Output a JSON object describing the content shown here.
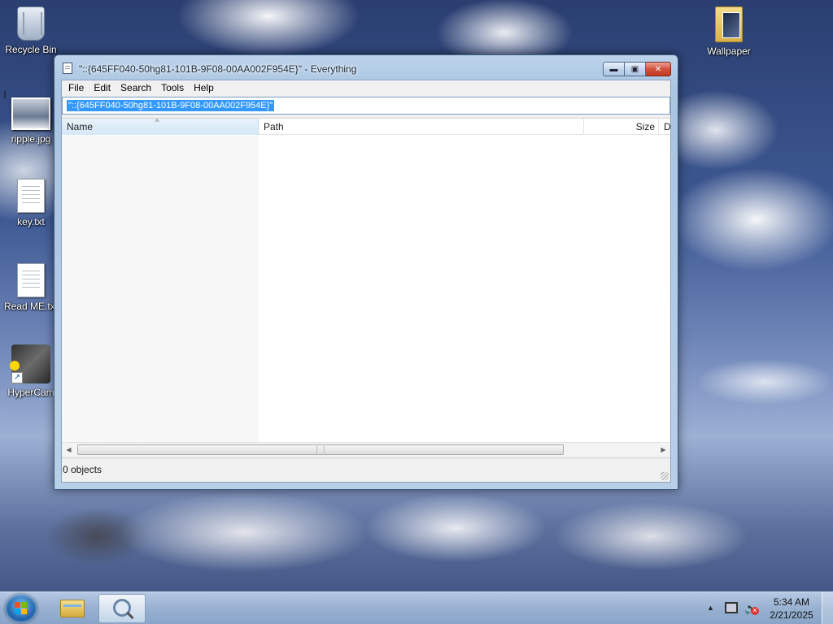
{
  "desktop": {
    "icons": [
      {
        "label": "Recycle Bin",
        "icon": "recycle-bin-icon"
      },
      {
        "label": "ripple.jpg",
        "icon": "image-file-icon"
      },
      {
        "label": "key.txt",
        "icon": "text-file-icon"
      },
      {
        "label": "Read ME.txt",
        "icon": "text-file-icon"
      },
      {
        "label": "HyperCam",
        "icon": "hypercam-icon"
      },
      {
        "label": "Wallpaper",
        "icon": "folder-icon"
      }
    ]
  },
  "window": {
    "title": "\"::{645FF040-50hg81-101B-9F08-00AA002F954E}\"  - Everything",
    "menu": [
      "File",
      "Edit",
      "Search",
      "Tools",
      "Help"
    ],
    "search_value": "\"::{645FF040-50hg81-101B-9F08-00AA002F954E}\"",
    "columns": {
      "name": "Name",
      "path": "Path",
      "size": "Size",
      "date": "D"
    },
    "status": "0 objects",
    "caption_buttons": {
      "minimize": "minimize-icon",
      "maximize": "maximize-icon",
      "close": "close-icon"
    }
  },
  "taskbar": {
    "items": [
      "windows-explorer",
      "everything"
    ],
    "clock": {
      "time": "5:34 AM",
      "date": "2/21/2025"
    },
    "tray": [
      "show-hidden-icons",
      "network-icon",
      "volume-muted-icon"
    ]
  }
}
